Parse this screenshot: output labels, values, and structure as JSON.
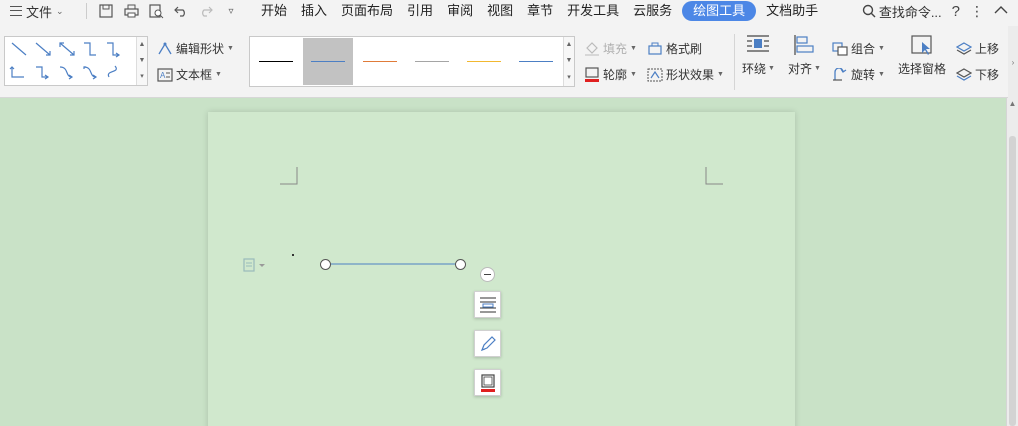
{
  "menu": {
    "file_label": "文件",
    "tabs": [
      "开始",
      "插入",
      "页面布局",
      "引用",
      "审阅",
      "视图",
      "章节",
      "开发工具",
      "云服务",
      "绘图工具",
      "文档助手"
    ],
    "active_tab": "绘图工具",
    "search_label": "查找命令...",
    "help_label": "?",
    "more_label": "⋮",
    "collapse_label": "^"
  },
  "ribbon": {
    "edit_shape": "编辑形状",
    "text_box": "文本框",
    "fill": "填充",
    "format_painter": "格式刷",
    "outline": "轮廓",
    "shape_effect": "形状效果",
    "wrap": "环绕",
    "align": "对齐",
    "group": "组合",
    "rotate": "旋转",
    "select_pane": "选择窗格",
    "bring_forward": "上移",
    "send_backward": "下移",
    "line_styles": [
      {
        "color": "#000000",
        "selected": false
      },
      {
        "color": "#4c7fc4",
        "selected": true
      },
      {
        "color": "#e07b39",
        "selected": false
      },
      {
        "color": "#a5a5a5",
        "selected": false
      },
      {
        "color": "#f2b830",
        "selected": false
      },
      {
        "color": "#4c7fc4",
        "selected": false
      }
    ]
  },
  "document": {
    "line_color": "#4c7fc4"
  }
}
